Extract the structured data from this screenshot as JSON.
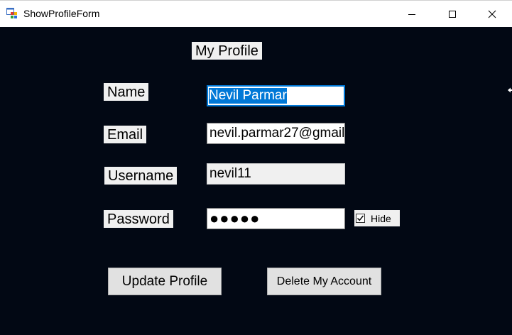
{
  "window": {
    "title": "ShowProfileForm"
  },
  "icons": {
    "app": "form-app-icon",
    "minimize": "minimize-icon",
    "maximize": "maximize-icon",
    "close": "close-icon",
    "checkmark": "checkmark-icon",
    "cursor": "resize-cursor-icon"
  },
  "colors": {
    "form_background": "#020814",
    "label_background": "#f0f0f0",
    "selection": "#0078d7"
  },
  "form": {
    "heading": "My Profile",
    "name": {
      "label": "Name",
      "value": "Nevil Parmar"
    },
    "email": {
      "label": "Email",
      "value": "nevil.parmar27@gmail"
    },
    "username": {
      "label": "Username",
      "value": "nevil11"
    },
    "password": {
      "label": "Password",
      "masked_value": "●●●●●"
    },
    "hide_checkbox": {
      "label": "Hide",
      "checked": true
    },
    "buttons": {
      "update": "Update Profile",
      "delete": "Delete My Account"
    }
  }
}
